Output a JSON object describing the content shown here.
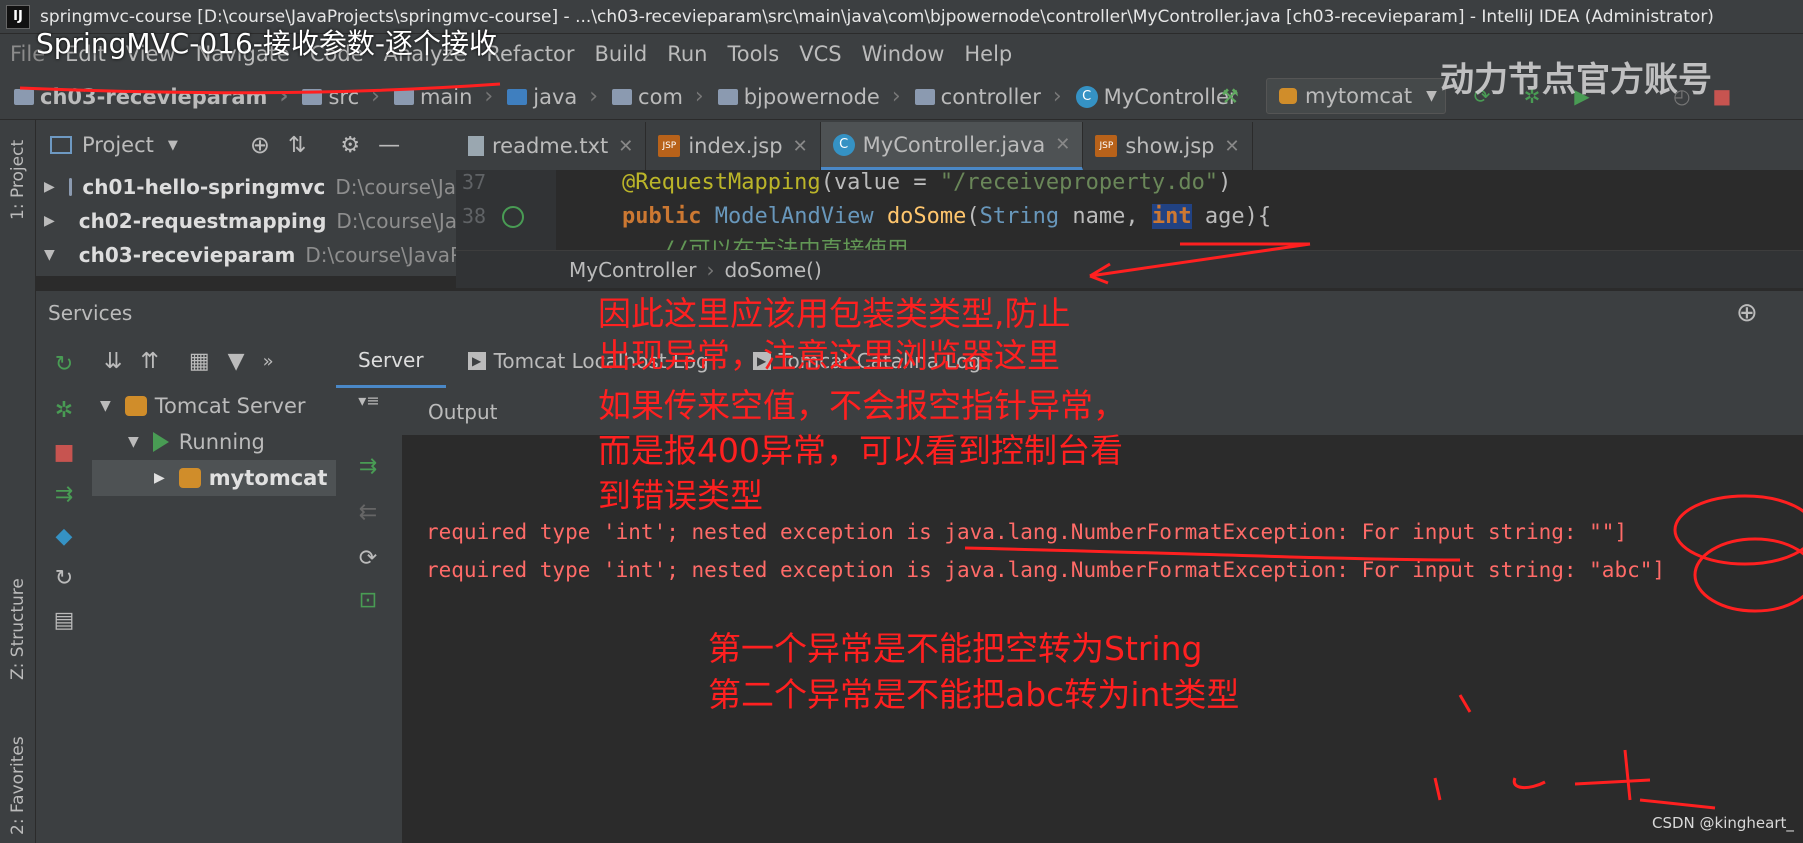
{
  "window": {
    "title": "springmvc-course [D:\\course\\JavaProjects\\springmvc-course] - ...\\ch03-recevieparam\\src\\main\\java\\com\\bjpowernode\\controller\\MyController.java [ch03-recevieparam] - IntelliJ IDEA (Administrator)",
    "app_icon": "IJ"
  },
  "video_overlay_title": "SpringMVC-016-接收参数-逐个接收",
  "watermark": "动力节点官方账号",
  "menu": [
    "File",
    "Edit",
    "View",
    "Navigate",
    "Code",
    "Analyze",
    "Refactor",
    "Build",
    "Run",
    "Tools",
    "VCS",
    "Window",
    "Help"
  ],
  "breadcrumbs": [
    "ch03-recevieparam",
    "src",
    "main",
    "java",
    "com",
    "bjpowernode",
    "controller",
    "MyController"
  ],
  "run_config": "mytomcat",
  "project_panel": {
    "title": "Project",
    "items": [
      {
        "name": "ch01-hello-springmvc",
        "path": "D:\\course\\Ja"
      },
      {
        "name": "ch02-requestmapping",
        "path": "D:\\course\\Ja"
      },
      {
        "name": "ch03-recevieparam",
        "path": "D:\\course\\JavaP"
      }
    ]
  },
  "editor_tabs": [
    {
      "label": "readme.txt",
      "icon": "text-file-icon"
    },
    {
      "label": "index.jsp",
      "icon": "jsp-file-icon"
    },
    {
      "label": "MyController.java",
      "icon": "class-icon",
      "active": true
    },
    {
      "label": "show.jsp",
      "icon": "jsp-file-icon"
    }
  ],
  "code": {
    "line37_no": "37",
    "line38_no": "38",
    "line37": {
      "annotation": "@RequestMapping",
      "open": "(",
      "param": "value = ",
      "value": "\"/receiveproperty.do\"",
      "close": ")"
    },
    "line38": {
      "kw": "public",
      "type": "ModelAndView",
      "method": "doSome",
      "open": "(",
      "ptype": "String",
      "pname": " name, ",
      "sel": "int",
      "rest": " age){"
    },
    "line39": "//可以在方法中直接使用"
  },
  "editor_breadcrumb": [
    "MyController",
    "doSome()"
  ],
  "services": {
    "title": "Services",
    "tree": {
      "server": "Tomcat Server",
      "state": "Running",
      "instance": "mytomcat"
    },
    "tabs": [
      "Server",
      "Tomcat Localhost Log",
      "Tomcat Catalina Log"
    ],
    "output_label": "Output",
    "errors": [
      "required type 'int'; nested exception is java.lang.NumberFormatException: For input string: \"\"]",
      "required type 'int'; nested exception is java.lang.NumberFormatException: For input string: \"abc\"]"
    ]
  },
  "annotations": {
    "note1": [
      "因此这里应该用包装类类型,防止",
      "出现异常，注意这里浏览器这里",
      "如果传来空值，不会报空指针异常，",
      "而是报400异常，可以看到控制台看",
      "到错误类型"
    ],
    "note2": [
      "第一个异常是不能把空转为String",
      "第二个异常是不能把abc转为int类型"
    ]
  },
  "side_labels": [
    "1: Project",
    "Z: Structure",
    "2: Favorites"
  ],
  "credit": "CSDN @kingheart_",
  "colors": {
    "accent": "#4a88c7",
    "error": "#ff6b68",
    "annotation": "#ff2020"
  }
}
